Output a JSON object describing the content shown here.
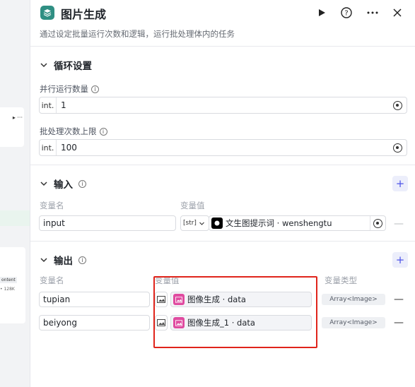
{
  "background": {
    "badge": "ontent",
    "meta": "• 128K"
  },
  "header": {
    "title": "图片生成",
    "description": "通过设定批量运行次数和逻辑，运行批处理体内的任务"
  },
  "loop": {
    "section_title": "循环设置",
    "parallel": {
      "label": "并行运行数量",
      "type": "int.",
      "value": "1"
    },
    "limit": {
      "label": "批处理次数上限",
      "type": "int.",
      "value": "100"
    }
  },
  "input": {
    "section_title": "输入",
    "col_name": "变量名",
    "col_value": "变量值",
    "rows": [
      {
        "name": "input",
        "type": "[str]",
        "ref": "文生图提示词 · wenshengtu"
      }
    ]
  },
  "output": {
    "section_title": "输出",
    "col_name": "变量名",
    "col_value": "变量值",
    "col_type": "变量类型",
    "rows": [
      {
        "name": "tupian",
        "ref": "图像生成 · data",
        "type": "Array<Image>"
      },
      {
        "name": "beiyong",
        "ref": "图像生成_1 · data",
        "type": "Array<Image>"
      }
    ]
  },
  "colors": {
    "brand": "#2f8f83",
    "accent": "#4d53e8",
    "highlight": "#e0241b",
    "image_node": "#e04ba0"
  }
}
